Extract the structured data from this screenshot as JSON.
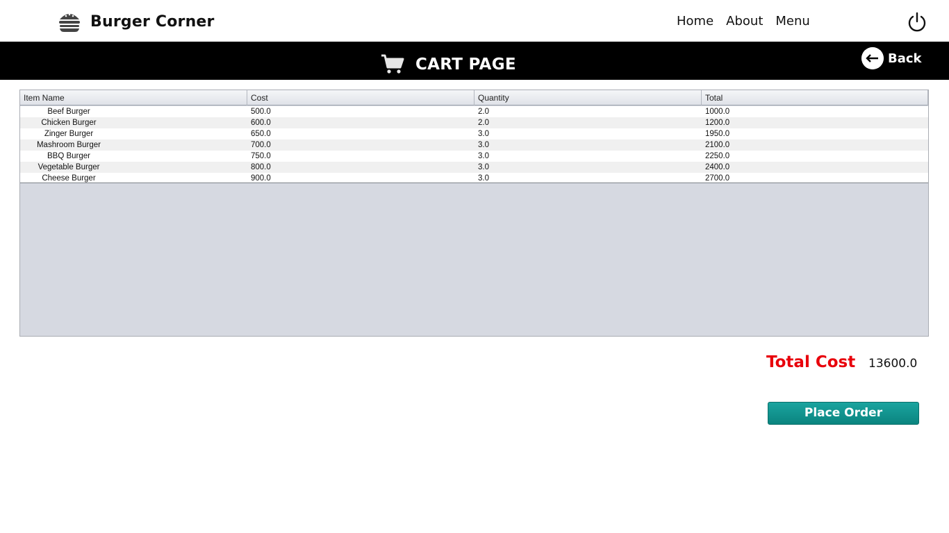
{
  "app": {
    "title": "Burger Corner",
    "logo_icon": "burger-icon"
  },
  "nav": {
    "items": [
      "Home",
      "About",
      "Menu"
    ],
    "power_icon": "power-icon"
  },
  "header": {
    "title": "CART PAGE",
    "cart_icon": "cart-icon",
    "back_label": "Back",
    "back_icon": "arrow-left-icon"
  },
  "table": {
    "columns": [
      "Item Name",
      "Cost",
      "Quantity",
      "Total"
    ],
    "rows": [
      [
        "Beef Burger",
        "500.0",
        "2.0",
        "1000.0"
      ],
      [
        "Chicken Burger",
        "600.0",
        "2.0",
        "1200.0"
      ],
      [
        "Zinger Burger",
        "650.0",
        "3.0",
        "1950.0"
      ],
      [
        "Mashroom Burger",
        "700.0",
        "3.0",
        "2100.0"
      ],
      [
        "BBQ Burger",
        "750.0",
        "3.0",
        "2250.0"
      ],
      [
        "Vegetable Burger",
        "800.0",
        "3.0",
        "2400.0"
      ],
      [
        "Cheese Burger",
        "900.0",
        "3.0",
        "2700.0"
      ]
    ]
  },
  "summary": {
    "total_label": "Total Cost",
    "total_value": "13600.0",
    "place_order_label": "Place Order"
  },
  "colors": {
    "accent_red": "#e8000b",
    "button_teal": "#0f9690",
    "band": "#000000"
  }
}
